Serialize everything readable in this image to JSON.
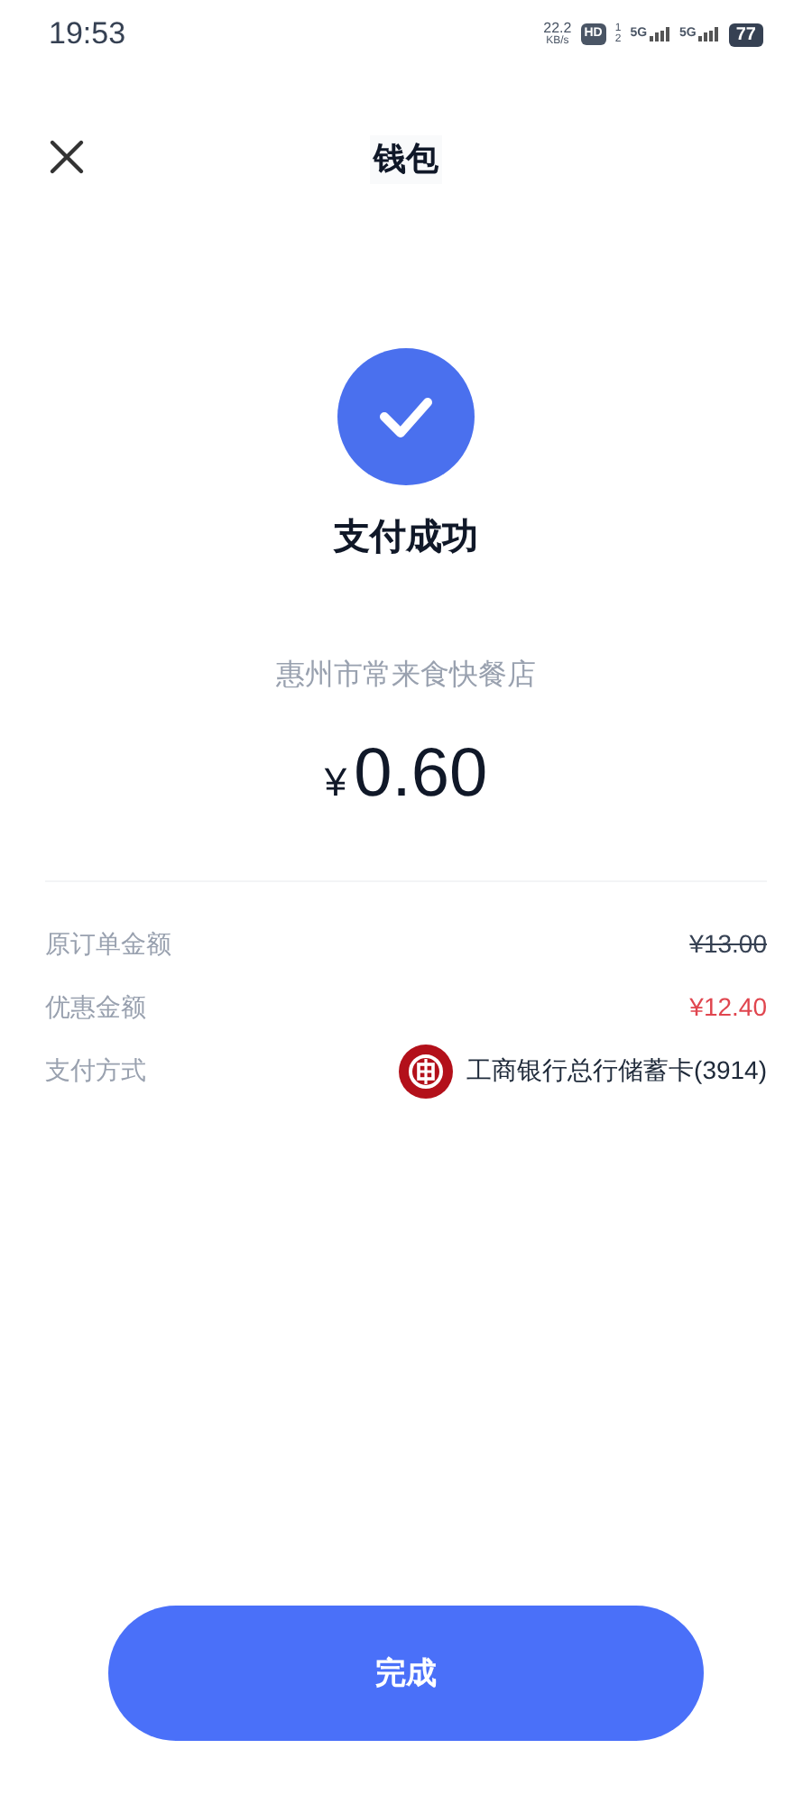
{
  "status_bar": {
    "time": "19:53",
    "speed_value": "22.2",
    "speed_unit": "KB/s",
    "hd": "HD",
    "sim_slots": [
      "1",
      "2"
    ],
    "networks": [
      "5G",
      "5G"
    ],
    "battery": "77"
  },
  "header": {
    "title": "钱包"
  },
  "result": {
    "title": "支付成功",
    "merchant": "惠州市常来食快餐店",
    "currency": "¥",
    "amount": "0.60"
  },
  "details": [
    {
      "kind": "strike",
      "label": "原订单金额",
      "value": "¥13.00"
    },
    {
      "kind": "discount",
      "label": "优惠金额",
      "value": "¥12.40"
    },
    {
      "kind": "bank",
      "label": "支付方式",
      "value": "工商银行总行储蓄卡(3914)"
    }
  ],
  "done_button": "完成"
}
